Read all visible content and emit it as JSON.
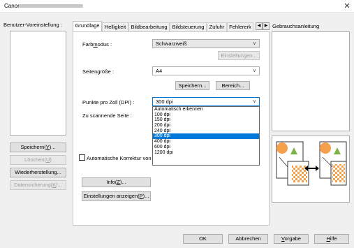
{
  "window": {
    "title": "Canon"
  },
  "left": {
    "preset_label": "Benutzer-Voreinstellung :",
    "buttons": {
      "save": "Speichern(Y)...",
      "delete": "Löschen(U)",
      "restore": "Wiederherstellung...",
      "backup": "Datensicherung(K)..."
    }
  },
  "tabs": [
    "Grundlage",
    "Helligkeit",
    "Bildbearbeitung",
    "Bildsteuerung",
    "Zufuhr",
    "Fehlererk"
  ],
  "help": {
    "label": "Gebrauchsanleitung"
  },
  "form": {
    "color_mode_label": "Farbmodus :",
    "color_mode_value": "Schwarzweiß",
    "settings_button": "Einstellungen...",
    "page_size_label": "Seitengröße :",
    "page_size_value": "A4",
    "save_button": "Speichern...",
    "area_button": "Bereich...",
    "dpi_label": "Punkte pro Zoll (DPI) :",
    "dpi_value": "300 dpi",
    "scan_side_label": "Zu scannende Seite :",
    "auto_correct_label": "Automatische Korrektur von S",
    "info_button": "Info(Z)...",
    "show_settings_button": "Einstellungen anzeigen(P)..."
  },
  "dpi_options": [
    "Automatisch erkennen",
    "100 dpi",
    "150 dpi",
    "200 dpi",
    "240 dpi",
    "300 dpi",
    "400 dpi",
    "600 dpi",
    "1200 dpi"
  ],
  "dpi_selected_index": 5,
  "footer": {
    "ok": "OK",
    "cancel": "Abbrechen",
    "default": "Vorgabe",
    "help": "Hilfe"
  },
  "colors": {
    "accent": "#0078d7",
    "orange": "#f5a04a",
    "green": "#7cb342"
  }
}
